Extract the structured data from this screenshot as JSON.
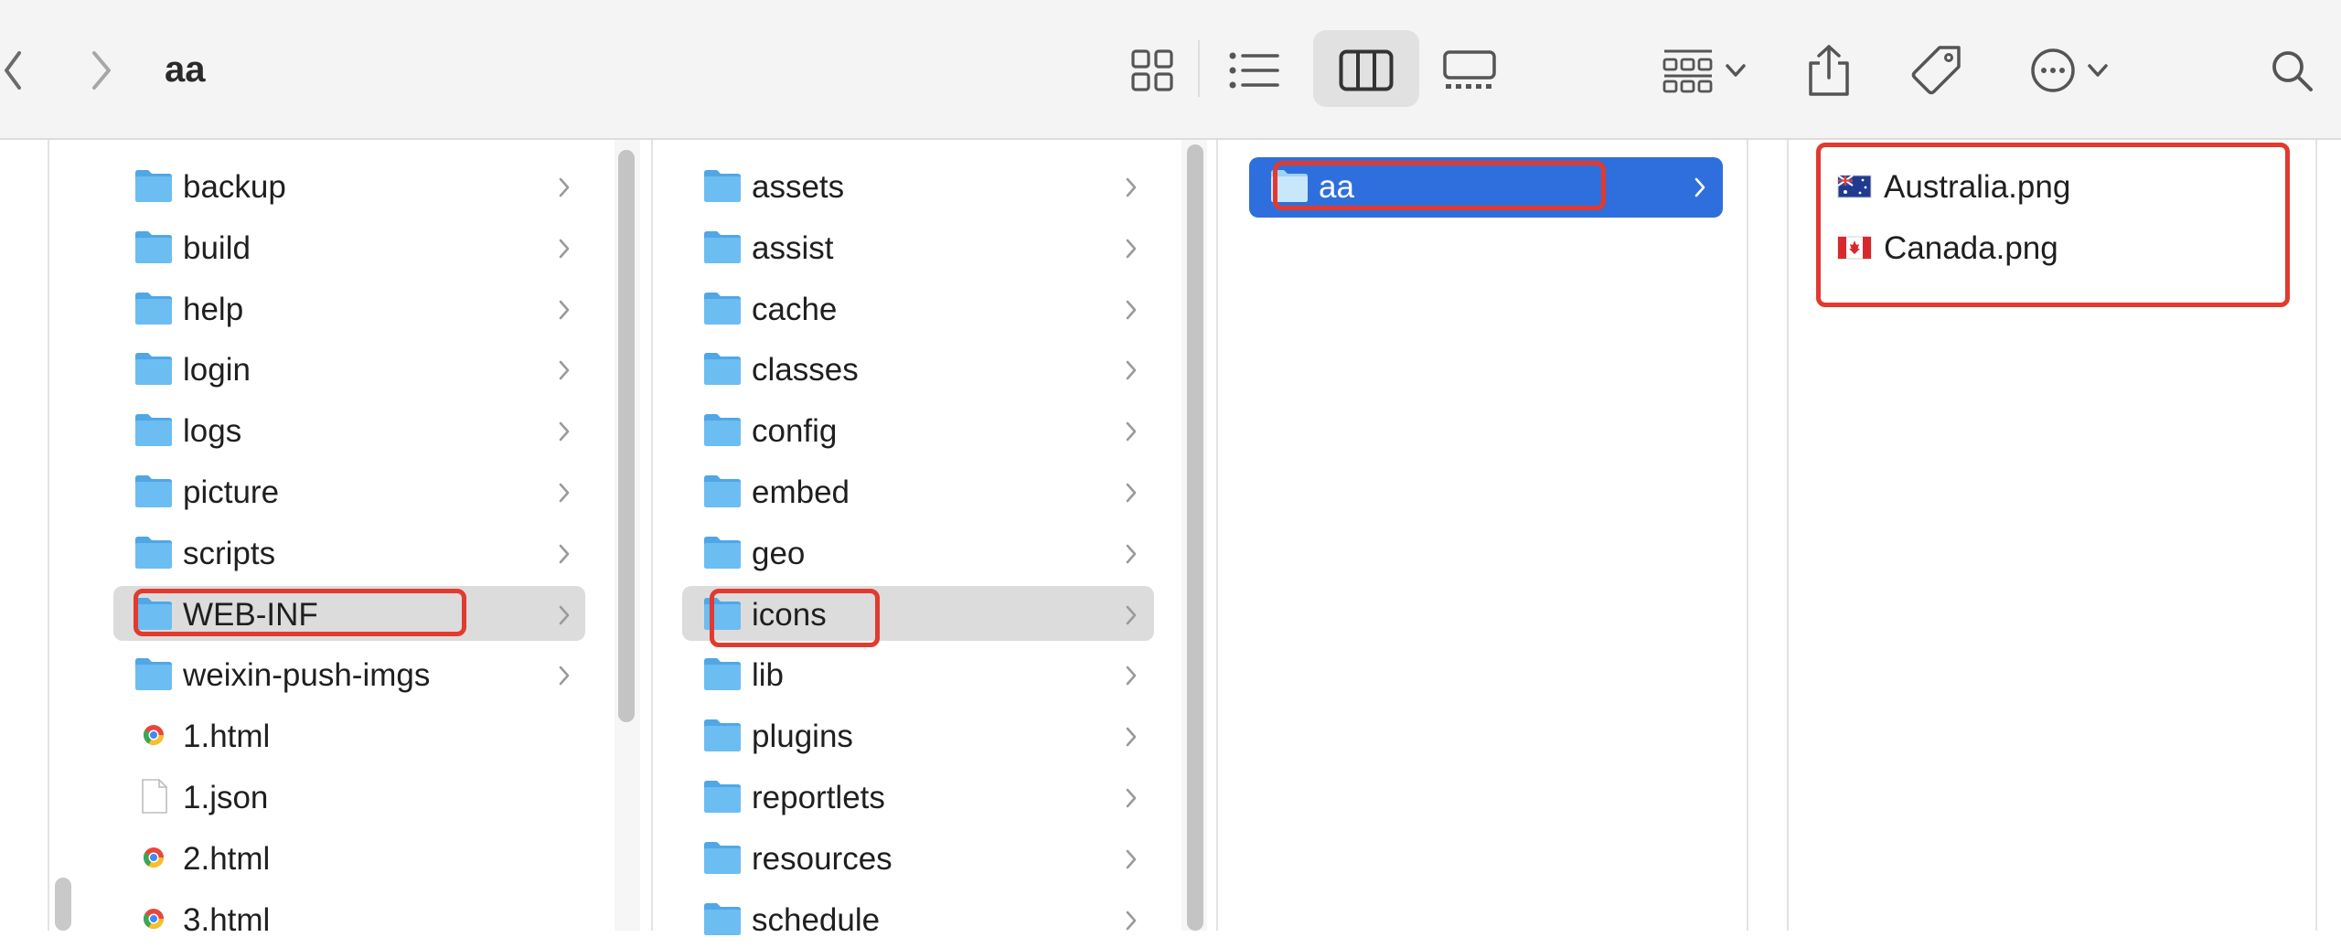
{
  "window": {
    "title": "aa"
  },
  "toolbar": {
    "back_icon": "chevron-left-icon",
    "forward_icon": "chevron-right-icon",
    "views": [
      "icon-view-icon",
      "list-view-icon",
      "column-view-icon",
      "gallery-view-icon"
    ],
    "active_view": "column-view-icon",
    "actions": [
      "group-icon",
      "share-icon",
      "tag-icon",
      "more-icon",
      "search-icon"
    ]
  },
  "columns": [
    {
      "items": [
        {
          "label": "backup",
          "type": "folder"
        },
        {
          "label": "build",
          "type": "folder"
        },
        {
          "label": "help",
          "type": "folder"
        },
        {
          "label": "login",
          "type": "folder"
        },
        {
          "label": "logs",
          "type": "folder"
        },
        {
          "label": "picture",
          "type": "folder"
        },
        {
          "label": "scripts",
          "type": "folder"
        },
        {
          "label": "WEB-INF",
          "type": "folder",
          "selected": true
        },
        {
          "label": "weixin-push-imgs",
          "type": "folder"
        },
        {
          "label": "1.html",
          "type": "html"
        },
        {
          "label": "1.json",
          "type": "file"
        },
        {
          "label": "2.html",
          "type": "html"
        },
        {
          "label": "3.html",
          "type": "html"
        }
      ]
    },
    {
      "items": [
        {
          "label": "assets",
          "type": "folder"
        },
        {
          "label": "assist",
          "type": "folder"
        },
        {
          "label": "cache",
          "type": "folder"
        },
        {
          "label": "classes",
          "type": "folder"
        },
        {
          "label": "config",
          "type": "folder"
        },
        {
          "label": "embed",
          "type": "folder"
        },
        {
          "label": "geo",
          "type": "folder"
        },
        {
          "label": "icons",
          "type": "folder",
          "selected": true
        },
        {
          "label": "lib",
          "type": "folder"
        },
        {
          "label": "plugins",
          "type": "folder"
        },
        {
          "label": "reportlets",
          "type": "folder"
        },
        {
          "label": "resources",
          "type": "folder"
        },
        {
          "label": "schedule",
          "type": "folder"
        }
      ]
    },
    {
      "items": [
        {
          "label": "aa",
          "type": "folder",
          "selected": true,
          "active": true
        }
      ]
    },
    {
      "items": [
        {
          "label": "Australia.png",
          "type": "image-australia"
        },
        {
          "label": "Canada.png",
          "type": "image-canada"
        }
      ]
    }
  ],
  "colors": {
    "selection_blue": "#2f6fdd",
    "selection_gray": "#dcdcdc",
    "folder_blue": "#62b8f0",
    "annotation_red": "#e23a2f"
  }
}
